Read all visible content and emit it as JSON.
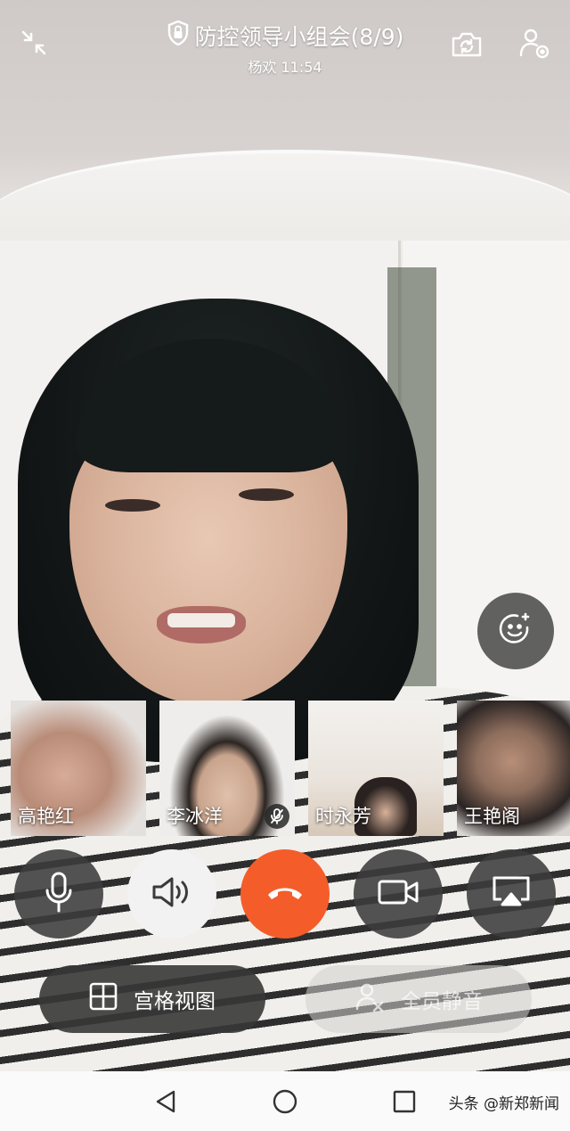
{
  "header": {
    "title": "防控领导小组会(8/9)",
    "subtitle": "杨欢 11:54",
    "icons": [
      "minimize-icon",
      "lock-shield-icon",
      "switch-camera-icon",
      "add-participant-icon"
    ]
  },
  "participants": [
    {
      "name": "高艳红",
      "muted": false
    },
    {
      "name": "李冰洋",
      "muted": true
    },
    {
      "name": "时永芳",
      "muted": false
    },
    {
      "name": "王艳阁",
      "muted": false
    }
  ],
  "controls": {
    "microphone": "microphone-icon",
    "speaker": "speaker-icon",
    "hangup": "hangup-icon",
    "camera": "video-camera-icon",
    "screen_share": "screen-share-icon",
    "hangup_color": "#f45d2a"
  },
  "actions": {
    "grid_view_label": "宫格视图",
    "mute_all_label": "全员静音"
  },
  "navbar": {
    "watermark": "头条 @新郑新闻"
  }
}
